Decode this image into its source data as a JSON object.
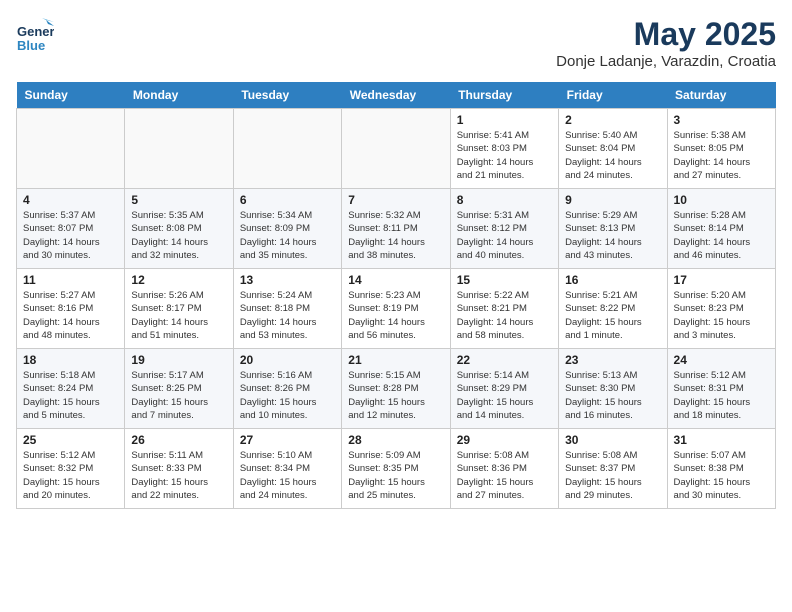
{
  "header": {
    "logo_line1": "General",
    "logo_line2": "Blue",
    "month_title": "May 2025",
    "location": "Donje Ladanje, Varazdin, Croatia"
  },
  "days_of_week": [
    "Sunday",
    "Monday",
    "Tuesday",
    "Wednesday",
    "Thursday",
    "Friday",
    "Saturday"
  ],
  "weeks": [
    [
      {
        "day": "",
        "info": ""
      },
      {
        "day": "",
        "info": ""
      },
      {
        "day": "",
        "info": ""
      },
      {
        "day": "",
        "info": ""
      },
      {
        "day": "1",
        "info": "Sunrise: 5:41 AM\nSunset: 8:03 PM\nDaylight: 14 hours\nand 21 minutes."
      },
      {
        "day": "2",
        "info": "Sunrise: 5:40 AM\nSunset: 8:04 PM\nDaylight: 14 hours\nand 24 minutes."
      },
      {
        "day": "3",
        "info": "Sunrise: 5:38 AM\nSunset: 8:05 PM\nDaylight: 14 hours\nand 27 minutes."
      }
    ],
    [
      {
        "day": "4",
        "info": "Sunrise: 5:37 AM\nSunset: 8:07 PM\nDaylight: 14 hours\nand 30 minutes."
      },
      {
        "day": "5",
        "info": "Sunrise: 5:35 AM\nSunset: 8:08 PM\nDaylight: 14 hours\nand 32 minutes."
      },
      {
        "day": "6",
        "info": "Sunrise: 5:34 AM\nSunset: 8:09 PM\nDaylight: 14 hours\nand 35 minutes."
      },
      {
        "day": "7",
        "info": "Sunrise: 5:32 AM\nSunset: 8:11 PM\nDaylight: 14 hours\nand 38 minutes."
      },
      {
        "day": "8",
        "info": "Sunrise: 5:31 AM\nSunset: 8:12 PM\nDaylight: 14 hours\nand 40 minutes."
      },
      {
        "day": "9",
        "info": "Sunrise: 5:29 AM\nSunset: 8:13 PM\nDaylight: 14 hours\nand 43 minutes."
      },
      {
        "day": "10",
        "info": "Sunrise: 5:28 AM\nSunset: 8:14 PM\nDaylight: 14 hours\nand 46 minutes."
      }
    ],
    [
      {
        "day": "11",
        "info": "Sunrise: 5:27 AM\nSunset: 8:16 PM\nDaylight: 14 hours\nand 48 minutes."
      },
      {
        "day": "12",
        "info": "Sunrise: 5:26 AM\nSunset: 8:17 PM\nDaylight: 14 hours\nand 51 minutes."
      },
      {
        "day": "13",
        "info": "Sunrise: 5:24 AM\nSunset: 8:18 PM\nDaylight: 14 hours\nand 53 minutes."
      },
      {
        "day": "14",
        "info": "Sunrise: 5:23 AM\nSunset: 8:19 PM\nDaylight: 14 hours\nand 56 minutes."
      },
      {
        "day": "15",
        "info": "Sunrise: 5:22 AM\nSunset: 8:21 PM\nDaylight: 14 hours\nand 58 minutes."
      },
      {
        "day": "16",
        "info": "Sunrise: 5:21 AM\nSunset: 8:22 PM\nDaylight: 15 hours\nand 1 minute."
      },
      {
        "day": "17",
        "info": "Sunrise: 5:20 AM\nSunset: 8:23 PM\nDaylight: 15 hours\nand 3 minutes."
      }
    ],
    [
      {
        "day": "18",
        "info": "Sunrise: 5:18 AM\nSunset: 8:24 PM\nDaylight: 15 hours\nand 5 minutes."
      },
      {
        "day": "19",
        "info": "Sunrise: 5:17 AM\nSunset: 8:25 PM\nDaylight: 15 hours\nand 7 minutes."
      },
      {
        "day": "20",
        "info": "Sunrise: 5:16 AM\nSunset: 8:26 PM\nDaylight: 15 hours\nand 10 minutes."
      },
      {
        "day": "21",
        "info": "Sunrise: 5:15 AM\nSunset: 8:28 PM\nDaylight: 15 hours\nand 12 minutes."
      },
      {
        "day": "22",
        "info": "Sunrise: 5:14 AM\nSunset: 8:29 PM\nDaylight: 15 hours\nand 14 minutes."
      },
      {
        "day": "23",
        "info": "Sunrise: 5:13 AM\nSunset: 8:30 PM\nDaylight: 15 hours\nand 16 minutes."
      },
      {
        "day": "24",
        "info": "Sunrise: 5:12 AM\nSunset: 8:31 PM\nDaylight: 15 hours\nand 18 minutes."
      }
    ],
    [
      {
        "day": "25",
        "info": "Sunrise: 5:12 AM\nSunset: 8:32 PM\nDaylight: 15 hours\nand 20 minutes."
      },
      {
        "day": "26",
        "info": "Sunrise: 5:11 AM\nSunset: 8:33 PM\nDaylight: 15 hours\nand 22 minutes."
      },
      {
        "day": "27",
        "info": "Sunrise: 5:10 AM\nSunset: 8:34 PM\nDaylight: 15 hours\nand 24 minutes."
      },
      {
        "day": "28",
        "info": "Sunrise: 5:09 AM\nSunset: 8:35 PM\nDaylight: 15 hours\nand 25 minutes."
      },
      {
        "day": "29",
        "info": "Sunrise: 5:08 AM\nSunset: 8:36 PM\nDaylight: 15 hours\nand 27 minutes."
      },
      {
        "day": "30",
        "info": "Sunrise: 5:08 AM\nSunset: 8:37 PM\nDaylight: 15 hours\nand 29 minutes."
      },
      {
        "day": "31",
        "info": "Sunrise: 5:07 AM\nSunset: 8:38 PM\nDaylight: 15 hours\nand 30 minutes."
      }
    ]
  ]
}
